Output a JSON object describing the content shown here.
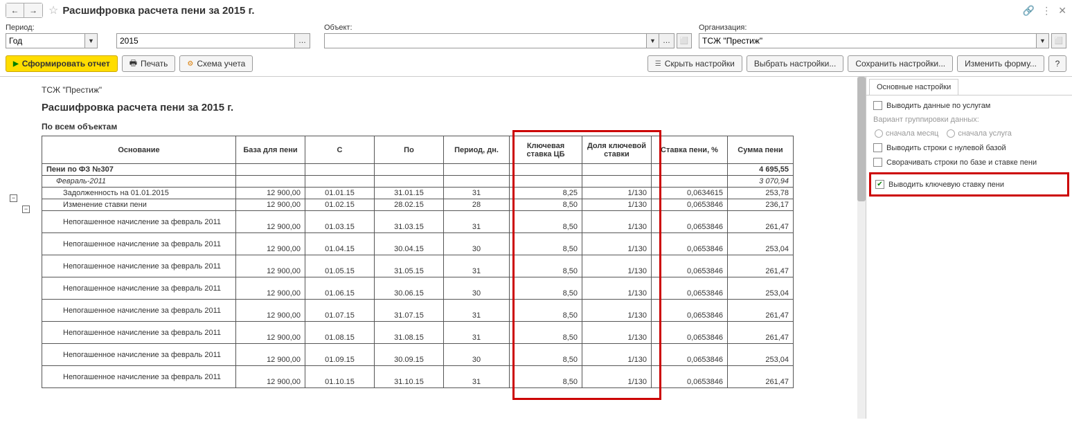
{
  "title": "Расшифровка расчета пени  за 2015 г.",
  "filters": {
    "period_label": "Период:",
    "period_type": "Год",
    "period_year": "2015",
    "object_label": "Объект:",
    "object_value": "",
    "org_label": "Организация:",
    "org_value": "ТСЖ \"Престиж\""
  },
  "toolbar": {
    "form_report": "Сформировать отчет",
    "print": "Печать",
    "scheme": "Схема учета",
    "hide_settings": "Скрыть настройки",
    "choose_settings": "Выбрать настройки...",
    "save_settings": "Сохранить настройки...",
    "change_form": "Изменить форму...",
    "help": "?"
  },
  "report": {
    "org": "ТСЖ \"Престиж\"",
    "title": "Расшифровка расчета пени за 2015 г.",
    "subtitle": "По всем объектам",
    "headers": {
      "osn": "Основание",
      "base": "База для пени",
      "c": "С",
      "po": "По",
      "period": "Период, дн.",
      "key_rate": "Ключевая ставка ЦБ",
      "share": "Доля ключевой ставки",
      "rate": "Ставка пени, %",
      "sum": "Сумма пени"
    },
    "group1": {
      "name": "Пени по ФЗ №307",
      "sum": "4 695,55"
    },
    "group2": {
      "name": "Февраль-2011",
      "sum": "3 070,94"
    },
    "rows": [
      {
        "osn": "Задолженность на 01.01.2015",
        "base": "12 900,00",
        "c": "01.01.15",
        "po": "31.01.15",
        "per": "31",
        "key": "8,25",
        "share": "1/130",
        "rate": "0,0634615",
        "sum": "253,78"
      },
      {
        "osn": "Изменение ставки пени",
        "base": "12 900,00",
        "c": "01.02.15",
        "po": "28.02.15",
        "per": "28",
        "key": "8,50",
        "share": "1/130",
        "rate": "0,0653846",
        "sum": "236,17"
      },
      {
        "osn": "Непогашенное начисление за февраль 2011",
        "base": "12 900,00",
        "c": "01.03.15",
        "po": "31.03.15",
        "per": "31",
        "key": "8,50",
        "share": "1/130",
        "rate": "0,0653846",
        "sum": "261,47"
      },
      {
        "osn": "Непогашенное начисление за февраль 2011",
        "base": "12 900,00",
        "c": "01.04.15",
        "po": "30.04.15",
        "per": "30",
        "key": "8,50",
        "share": "1/130",
        "rate": "0,0653846",
        "sum": "253,04"
      },
      {
        "osn": "Непогашенное начисление за февраль 2011",
        "base": "12 900,00",
        "c": "01.05.15",
        "po": "31.05.15",
        "per": "31",
        "key": "8,50",
        "share": "1/130",
        "rate": "0,0653846",
        "sum": "261,47"
      },
      {
        "osn": "Непогашенное начисление за февраль 2011",
        "base": "12 900,00",
        "c": "01.06.15",
        "po": "30.06.15",
        "per": "30",
        "key": "8,50",
        "share": "1/130",
        "rate": "0,0653846",
        "sum": "253,04"
      },
      {
        "osn": "Непогашенное начисление за февраль 2011",
        "base": "12 900,00",
        "c": "01.07.15",
        "po": "31.07.15",
        "per": "31",
        "key": "8,50",
        "share": "1/130",
        "rate": "0,0653846",
        "sum": "261,47"
      },
      {
        "osn": "Непогашенное начисление за февраль 2011",
        "base": "12 900,00",
        "c": "01.08.15",
        "po": "31.08.15",
        "per": "31",
        "key": "8,50",
        "share": "1/130",
        "rate": "0,0653846",
        "sum": "261,47"
      },
      {
        "osn": "Непогашенное начисление за февраль 2011",
        "base": "12 900,00",
        "c": "01.09.15",
        "po": "30.09.15",
        "per": "30",
        "key": "8,50",
        "share": "1/130",
        "rate": "0,0653846",
        "sum": "253,04"
      },
      {
        "osn": "Непогашенное начисление за февраль 2011",
        "base": "12 900,00",
        "c": "01.10.15",
        "po": "31.10.15",
        "per": "31",
        "key": "8,50",
        "share": "1/130",
        "rate": "0,0653846",
        "sum": "261,47"
      }
    ]
  },
  "settings": {
    "tab": "Основные настройки",
    "by_services": "Выводить данные по услугам",
    "group_variant": "Вариант группировки данных:",
    "month_first": "сначала месяц",
    "service_first": "сначала услуга",
    "zero_rows": "Выводить строки с нулевой базой",
    "collapse_rows": "Сворачивать строки по базе и ставке пени",
    "show_key_rate": "Выводить ключевую ставку пени"
  }
}
